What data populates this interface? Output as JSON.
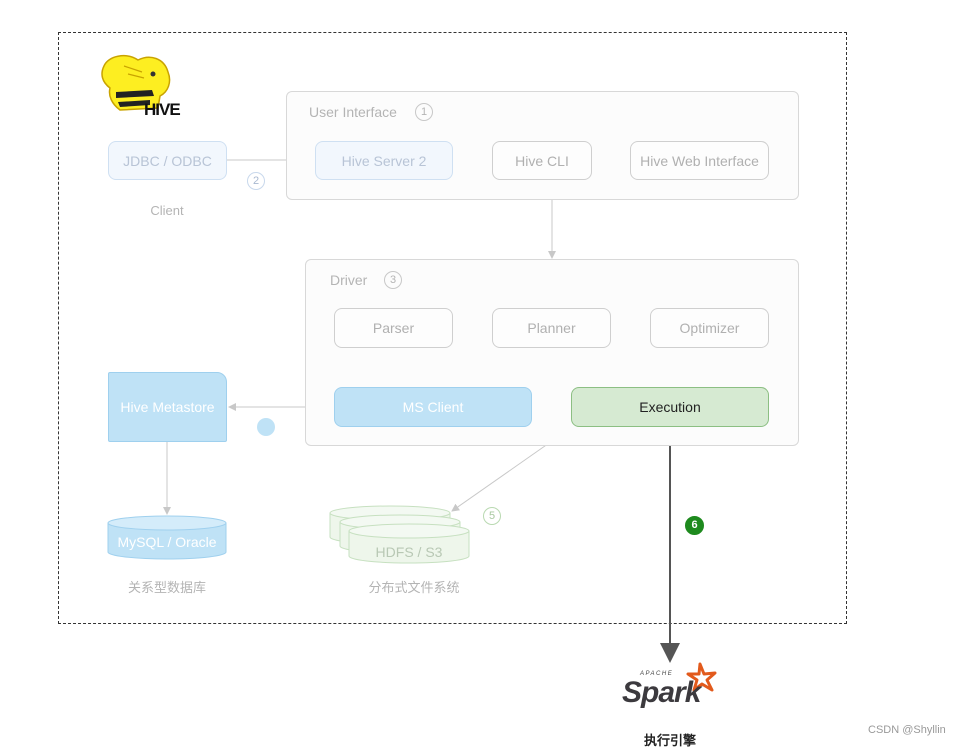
{
  "logo": {
    "text": "HIVE",
    "icon": "hive-bee-elephant-icon"
  },
  "client": {
    "jdbc_label": "JDBC / ODBC",
    "caption": "Client",
    "step": "2"
  },
  "user_interface": {
    "title": "User Interface",
    "step": "1",
    "items": [
      "Hive Server 2",
      "Hive CLI",
      "Hive Web Interface"
    ]
  },
  "driver": {
    "title": "Driver",
    "step": "3",
    "items": [
      "Parser",
      "Planner",
      "Optimizer"
    ],
    "ms_client": "MS Client",
    "execution": "Execution"
  },
  "metastore": {
    "label": "Hive Metastore",
    "step": ""
  },
  "rdbms": {
    "label": "MySQL / Oracle",
    "caption": "关系型数据库"
  },
  "hdfs": {
    "label": "HDFS / S3",
    "caption": "分布式文件系统",
    "step": "5"
  },
  "spark": {
    "step": "6",
    "apache": "APACHE",
    "name": "Spark",
    "caption": "执行引擎"
  },
  "watermark": "CSDN @Shyllin",
  "colors": {
    "execution_green": "#1e8a1e",
    "metastore_blue": "#bfe2f6"
  }
}
